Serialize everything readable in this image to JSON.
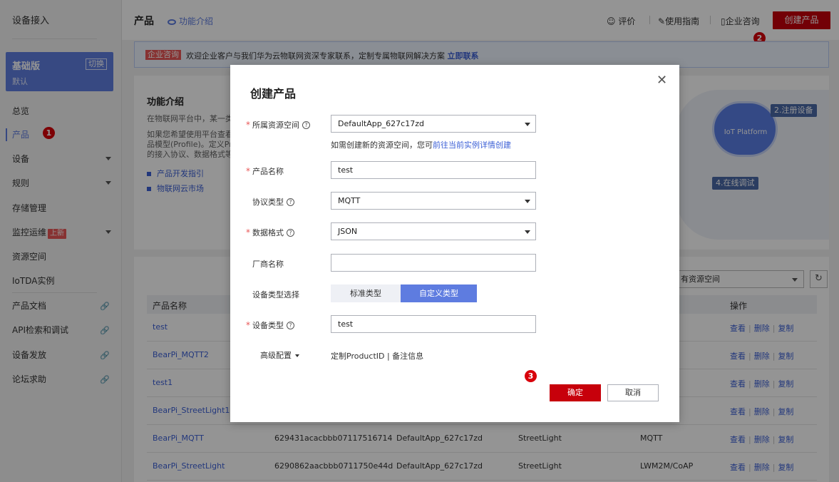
{
  "sidebar": {
    "title": "设备接入",
    "plan": {
      "name": "基础版",
      "sub": "默认",
      "switch": "切换"
    },
    "items": [
      {
        "label": "总览"
      },
      {
        "label": "产品"
      },
      {
        "label": "设备"
      },
      {
        "label": "规则"
      },
      {
        "label": "存储管理"
      },
      {
        "label": "监控运维",
        "badge": "上新"
      },
      {
        "label": "资源空间"
      },
      {
        "label": "IoTDA实例"
      },
      {
        "label": "产品文档"
      },
      {
        "label": "API检索和调试"
      },
      {
        "label": "设备发放"
      },
      {
        "label": "论坛求助"
      }
    ]
  },
  "header": {
    "title": "产品",
    "intro": "功能介绍",
    "rate": "评价",
    "guide": "使用指南",
    "consult": "企业咨询",
    "create": "创建产品"
  },
  "banner": {
    "tag": "企业咨询",
    "text": "欢迎企业客户与我们华为云物联网资深专家联系，定制专属物联网解决方案",
    "link": "立即联系"
  },
  "intro_card": {
    "title": "功能介绍",
    "line1": "在物联网平台中，某一类",
    "line2": "如果您希望使用平台查看",
    "line3": "品模型(Profile)。定义Pro",
    "line4": "的接入协议、数据格式等",
    "link1": "产品开发指引",
    "link2": "物联网云市场",
    "cloud": "IoT Platform",
    "step2": "2.注册设备",
    "step4": "4.在线调试"
  },
  "list_card": {
    "select": "有资源空间",
    "refresh": "↻",
    "headers": {
      "name": "产品名称",
      "ops": "操作"
    },
    "ops": {
      "view": "查看",
      "delete": "删除",
      "copy": "复制"
    },
    "rows": [
      {
        "name": "test",
        "id": "",
        "app": "",
        "type": "",
        "proto": ""
      },
      {
        "name": "BearPi_MQTT2",
        "id": "",
        "app": "",
        "type": "",
        "proto": ""
      },
      {
        "name": "test1",
        "id": "",
        "app": "",
        "type": "",
        "proto": ""
      },
      {
        "name": "BearPi_StreetLight1",
        "id": "",
        "app": "",
        "type": "",
        "proto": ""
      },
      {
        "name": "BearPi_MQTT",
        "id": "629431acacbbb07117516714",
        "app": "DefaultApp_627c17zd",
        "type": "StreetLight",
        "proto": "MQTT"
      },
      {
        "name": "BearPi_StreetLight",
        "id": "6290862aacbbb0711750e44d",
        "app": "DefaultApp_627c17zd",
        "type": "StreetLight",
        "proto": "LWM2M/CoAP"
      }
    ]
  },
  "modal": {
    "title": "创建产品",
    "close": "✕",
    "resource_space": {
      "label": "所属资源空间",
      "value": "DefaultApp_627c17zd"
    },
    "hint": {
      "text": "如需创建新的资源空间，您可",
      "link": "前往当前实例详情创建"
    },
    "product_name": {
      "label": "产品名称",
      "value": "test"
    },
    "protocol": {
      "label": "协议类型",
      "value": "MQTT"
    },
    "data_format": {
      "label": "数据格式",
      "value": "JSON"
    },
    "vendor": {
      "label": "厂商名称",
      "value": ""
    },
    "device_type_select": {
      "label": "设备类型选择",
      "standard": "标准类型",
      "custom": "自定义类型"
    },
    "device_type": {
      "label": "设备类型",
      "value": "test"
    },
    "advanced": {
      "label": "高级配置",
      "links": "定制ProductID | 备注信息"
    },
    "ok": "确定",
    "cancel": "取消"
  },
  "markers": {
    "m1": "1",
    "m2": "2",
    "m3": "3"
  }
}
